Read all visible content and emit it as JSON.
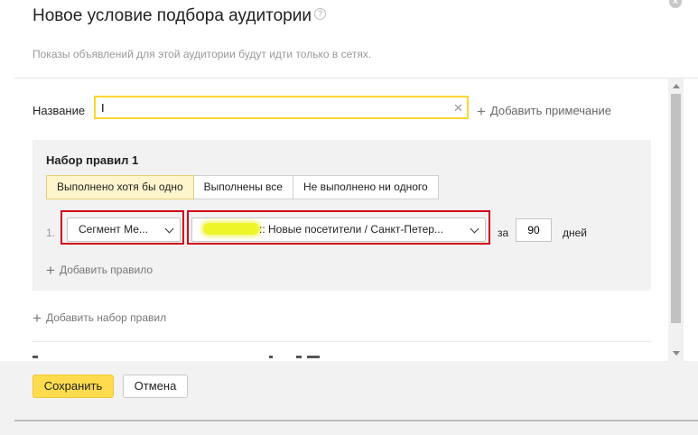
{
  "dialog": {
    "title": "Новое условие подбора аудитории",
    "help_symbol": "?",
    "close_symbol": "×",
    "subtitle": "Показы объявлений для этой аудитории будут идти только в сетях."
  },
  "name_field": {
    "label": "Название",
    "value": "I",
    "clear_symbol": "✕"
  },
  "add_note": {
    "plus": "+",
    "label": "Добавить примечание"
  },
  "ruleset": {
    "title": "Набор правил 1",
    "modes": [
      {
        "label": "Выполнено хотя бы одно",
        "active": true
      },
      {
        "label": "Выполнены все",
        "active": false
      },
      {
        "label": "Не выполнено ни одного",
        "active": false
      }
    ],
    "rules": [
      {
        "number": "1.",
        "type_select": "Сегмент Ме...",
        "segment_select": ":: Новые посетители / Санкт-Петер...",
        "period_prefix": "за",
        "days": "90",
        "days_label": "дней"
      }
    ],
    "add_rule": {
      "plus": "+",
      "label": "Добавить правило"
    }
  },
  "add_ruleset": {
    "plus": "+",
    "label": "Добавить набор правил"
  },
  "footer": {
    "save_label": "Сохранить",
    "cancel_label": "Отмена"
  },
  "colors": {
    "highlight_red": "#d0021b",
    "save_yellow": "#ffdb4d",
    "active_mode": "#fff5cd",
    "input_focus": "#ffd530"
  }
}
